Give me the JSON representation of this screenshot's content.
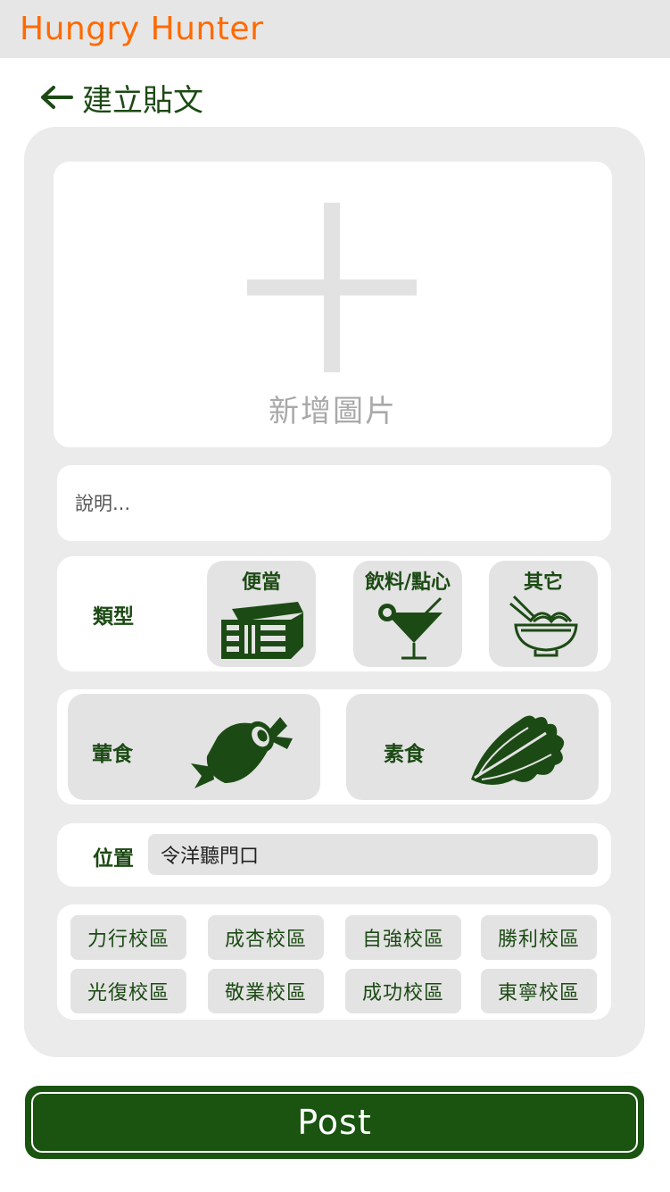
{
  "app": {
    "title": "Hungry Hunter"
  },
  "header": {
    "title": "建立貼文"
  },
  "upload": {
    "label": "新增圖片"
  },
  "description": {
    "placeholder": "說明..."
  },
  "category": {
    "label": "類型",
    "options": [
      {
        "label": "便當",
        "icon": "bento-box-icon"
      },
      {
        "label": "飲料/點心",
        "icon": "cocktail-icon"
      },
      {
        "label": "其它",
        "icon": "noodle-bowl-icon"
      }
    ]
  },
  "diet": {
    "options": [
      {
        "label": "葷食",
        "icon": "meat-icon"
      },
      {
        "label": "素食",
        "icon": "lettuce-icon"
      }
    ]
  },
  "location": {
    "label": "位置",
    "value": "令洋聽門口"
  },
  "campuses": [
    "力行校區",
    "成杏校區",
    "自強校區",
    "勝利校區",
    "光復校區",
    "敬業校區",
    "成功校區",
    "東寧校區"
  ],
  "post_button": {
    "label": "Post"
  },
  "colors": {
    "brand_orange": "#ff6a00",
    "accent_green": "#1a5410",
    "panel_gray": "#ebebeb",
    "chip_gray": "#e3e3e3"
  }
}
